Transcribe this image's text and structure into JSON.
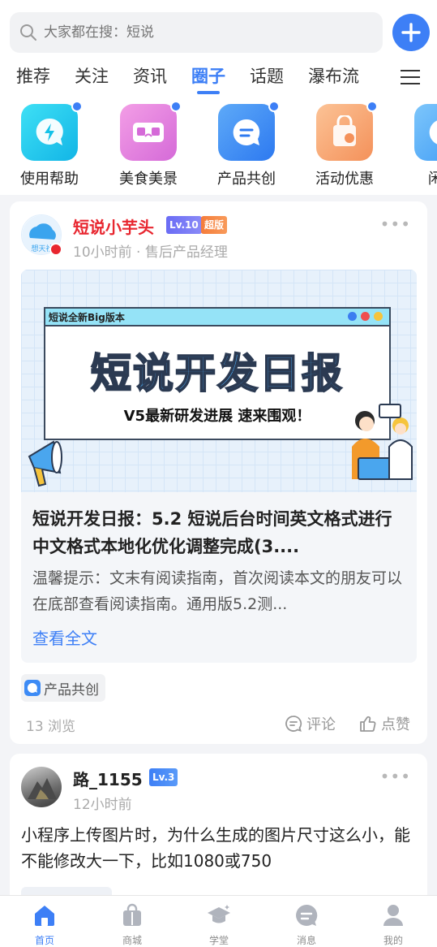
{
  "search": {
    "placeholder": "大家都在搜：短说"
  },
  "tabs": [
    {
      "label": "推荐"
    },
    {
      "label": "关注"
    },
    {
      "label": "资讯"
    },
    {
      "label": "圈子"
    },
    {
      "label": "话题"
    },
    {
      "label": "瀑布流"
    }
  ],
  "active_tab": "圈子",
  "categories": [
    {
      "label": "使用帮助",
      "icon": "lightning-bubble-icon",
      "color": "#14c2e8"
    },
    {
      "label": "美食美景",
      "icon": "vr-glasses-icon",
      "color": "#e56fd9"
    },
    {
      "label": "产品共创",
      "icon": "chat-bubble-icon",
      "color": "#3d8bf5"
    },
    {
      "label": "活动优惠",
      "icon": "shopping-bag-icon",
      "color": "#f7a36a"
    },
    {
      "label": "闲聊",
      "icon": "chat-icon",
      "color": "#4aa9f7"
    }
  ],
  "post1": {
    "author": "短说小芋头",
    "level": "Lv.10",
    "role_badge": "超版",
    "meta": "10小时前 · 售后产品经理",
    "avatar_text": "想天社",
    "banner": {
      "heading": "短说全新Big版本",
      "title": "短说开发日报",
      "subtitle": "V5最新研发进展 速来围观！"
    },
    "title": "短说开发日报：5.2 短说后台时间英文格式进行中文格式本地化优化调整完成(3....",
    "excerpt": "温馨提示：文末有阅读指南，首次阅读本文的朋友可以在底部查看阅读指南。通用版5.2测...",
    "read_more": "查看全文",
    "tag": "产品共创",
    "views": "13 浏览",
    "comment_label": "评论",
    "like_label": "点赞"
  },
  "post2": {
    "author": "路_1155",
    "level": "Lv.3",
    "meta": "12小时前",
    "body": "小程序上传图片时，为什么生成的图片尺寸这么小，能不能修改大一下，比如1080或750"
  },
  "bottom_nav": [
    {
      "label": "首页",
      "icon": "home-icon",
      "active": true
    },
    {
      "label": "商城",
      "icon": "shopping-bag-icon",
      "active": false
    },
    {
      "label": "学堂",
      "icon": "graduation-cap-icon",
      "active": false
    },
    {
      "label": "消息",
      "icon": "message-icon",
      "active": false
    },
    {
      "label": "我的",
      "icon": "user-icon",
      "active": false
    }
  ],
  "colors": {
    "accent": "#3d7ff6",
    "username_red": "#e8262f"
  }
}
